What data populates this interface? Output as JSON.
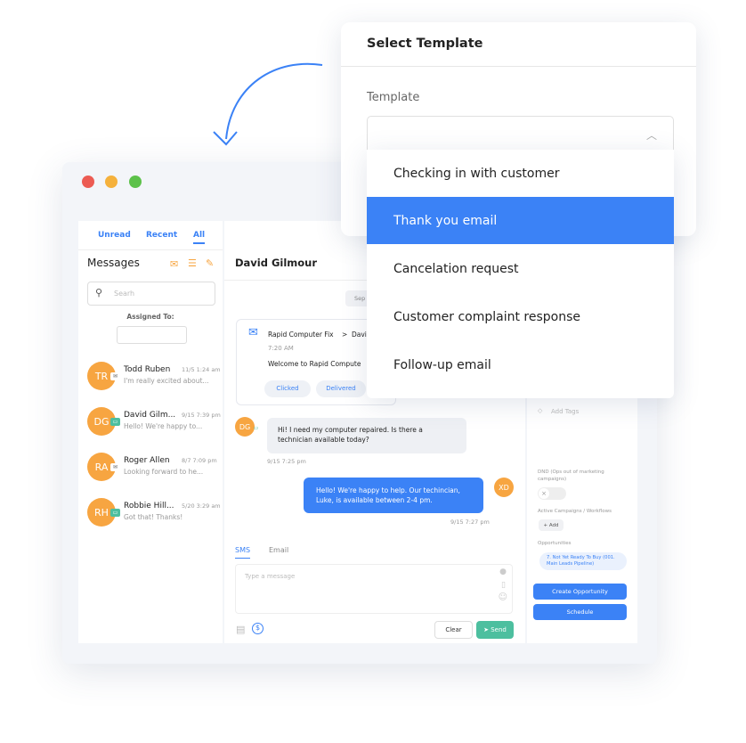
{
  "window": {
    "controls": [
      {
        "color": "#ec5b53"
      },
      {
        "color": "#f5b13c"
      },
      {
        "color": "#5cc14a"
      }
    ]
  },
  "sidebar": {
    "tabs": [
      "Unread",
      "Recent",
      "All"
    ],
    "active_tab": "All",
    "title": "Messages",
    "search_placeholder": "Searh",
    "assigned_label": "Assigned To:",
    "conversations": [
      {
        "initials": "TR",
        "name": "Todd Ruben",
        "time": "11/5 1:24 am",
        "preview": "I'm really excited about...",
        "channel": "email"
      },
      {
        "initials": "DG",
        "name": "David Gilm...",
        "time": "9/15 7:39 pm",
        "preview": "Hello! We're happy to...",
        "channel": "sms"
      },
      {
        "initials": "RA",
        "name": "Roger Allen",
        "time": "8/7 7:09 pm",
        "preview": "Looking forward to he...",
        "channel": "email"
      },
      {
        "initials": "RH",
        "name": "Robbie Hill...",
        "time": "5/20 3:29 am",
        "preview": "Got that! Thanks!",
        "channel": "sms"
      }
    ]
  },
  "chat": {
    "contact": "David Gilmour",
    "date_chip": "Sep",
    "email_card": {
      "from": "Rapid Computer Fix",
      "arrow": ">",
      "to": "Davi",
      "time": "7:20 AM",
      "subject": "Welcome to Rapid Compute",
      "tags": [
        "Clicked",
        "Delivered"
      ]
    },
    "messages": [
      {
        "initials": "DG",
        "text": "Hi! I need my computer repaired. Is there a technician available today?",
        "time": "9/15 7:25 pm",
        "direction": "in"
      },
      {
        "initials": "XD",
        "text": "Hello! We're happy to help. Our techincian, Luke, is available between 2-4 pm.",
        "time": "9/15 7:27 pm",
        "direction": "out"
      }
    ],
    "compose": {
      "tabs": [
        "SMS",
        "Email"
      ],
      "active_tab": "SMS",
      "placeholder": "Type a message",
      "clear": "Clear",
      "send": "Send"
    }
  },
  "details": {
    "add_tags": "Add Tags",
    "dnd_label": "DND (Ops out of marketing campaigns)",
    "dnd_on": false,
    "campaigns_label": "Active Campaigns / Workflows",
    "add": "+ Add",
    "opportunities_label": "Opportunities",
    "opportunity": "7. Not Yet Ready To Buy (001. Main Leads Pipeline)",
    "create_opportunity": "Create Opportunity",
    "schedule": "Schedule"
  },
  "template_modal": {
    "title": "Select Template",
    "field_label": "Template",
    "options": [
      "Checking in with customer",
      "Thank you email",
      "Cancelation request",
      "Customer complaint response",
      "Follow-up email"
    ],
    "selected": "Thank you email"
  },
  "colors": {
    "accent": "#3b82f6",
    "avatar": "#f7a541",
    "send": "#4dbf9f"
  }
}
